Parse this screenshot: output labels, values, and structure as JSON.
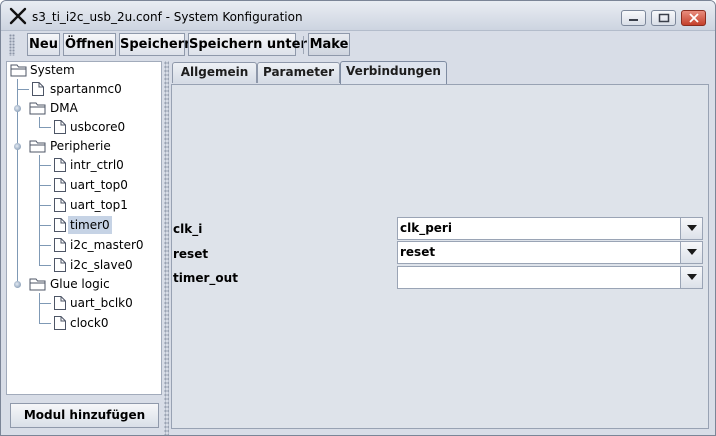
{
  "window": {
    "title": "s3_ti_i2c_usb_2u.conf - System Konfiguration",
    "controls": {
      "minimize": "minimize-icon",
      "maximize": "maximize-icon",
      "close": "close-icon"
    }
  },
  "toolbar": {
    "new_label": "Neu",
    "open_label": "Öffnen",
    "save_label": "Speichern",
    "save_as_label": "Speichern unter",
    "make_label": "Make"
  },
  "tree": {
    "root": "System",
    "items": [
      {
        "label": "spartanmc0",
        "type": "file"
      },
      {
        "label": "DMA",
        "type": "folder"
      },
      {
        "label": "usbcore0",
        "type": "file"
      },
      {
        "label": "Peripherie",
        "type": "folder"
      },
      {
        "label": "intr_ctrl0",
        "type": "file"
      },
      {
        "label": "uart_top0",
        "type": "file"
      },
      {
        "label": "uart_top1",
        "type": "file"
      },
      {
        "label": "timer0",
        "type": "file",
        "selected": true
      },
      {
        "label": "i2c_master0",
        "type": "file"
      },
      {
        "label": "i2c_slave0",
        "type": "file"
      },
      {
        "label": "Glue logic",
        "type": "folder"
      },
      {
        "label": "uart_bclk0",
        "type": "file"
      },
      {
        "label": "clock0",
        "type": "file"
      }
    ]
  },
  "add_module_label": "Modul hinzufügen",
  "tabs": [
    {
      "label": "Allgemein",
      "active": false
    },
    {
      "label": "Parameter",
      "active": false
    },
    {
      "label": "Verbindungen",
      "active": true
    }
  ],
  "connections": [
    {
      "label": "clk_i",
      "value": "clk_peri"
    },
    {
      "label": "reset",
      "value": "reset"
    },
    {
      "label": "timer_out",
      "value": ""
    }
  ],
  "colors": {
    "window_bg": "#d8dde7",
    "selection": "#c6d3e5",
    "close_button": "#c4402b"
  }
}
